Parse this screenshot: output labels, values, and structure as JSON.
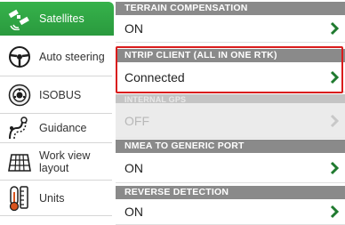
{
  "sidebar": {
    "items": [
      {
        "label": "Satellites",
        "icon": "satellite-icon",
        "active": true
      },
      {
        "label": "Auto steering",
        "icon": "steering-wheel-icon",
        "active": false
      },
      {
        "label": "ISOBUS",
        "icon": "isobus-icon",
        "active": false
      },
      {
        "label": "Guidance",
        "icon": "guidance-icon",
        "active": false
      },
      {
        "label": "Work view layout",
        "icon": "work-view-icon",
        "active": false
      },
      {
        "label": "Units",
        "icon": "thermometer-icon",
        "active": false
      }
    ]
  },
  "settings": [
    {
      "header": "TERRAIN COMPENSATION",
      "value": "ON",
      "enabled": true
    },
    {
      "header": "NTRIP CLIENT (ALL IN ONE RTK)",
      "value": "Connected",
      "enabled": true,
      "highlighted": true
    },
    {
      "header": "INTERNAL GPS",
      "value": "OFF",
      "enabled": false
    },
    {
      "header": "NMEA TO GENERIC PORT",
      "value": "ON",
      "enabled": true
    },
    {
      "header": "REVERSE DETECTION",
      "value": "ON",
      "enabled": true
    }
  ],
  "colors": {
    "accent": "#36b24b",
    "chevron": "#1f7a2f",
    "highlight": "#d91c1c",
    "header_bg": "#8a8a8a"
  }
}
